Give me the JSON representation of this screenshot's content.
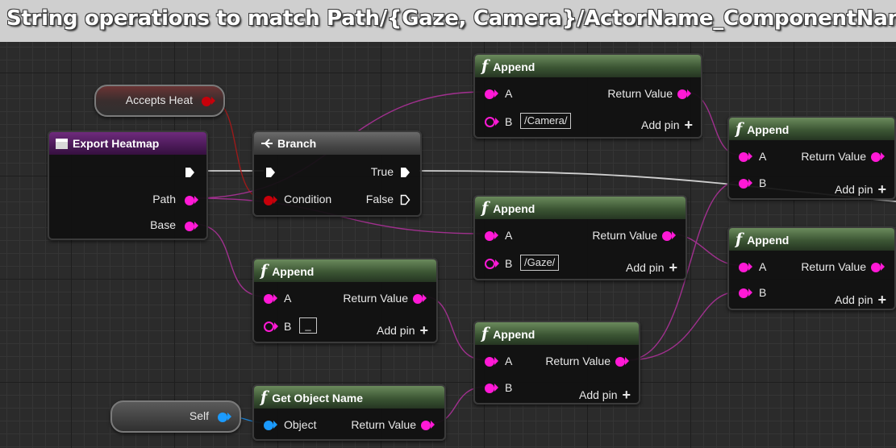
{
  "comment": {
    "title": "String operations to match Path/{Gaze, Camera}/ActorName_ComponentName"
  },
  "colors": {
    "string_pin": "#ff19d6",
    "object_pin": "#1b9bff",
    "bool_pin": "#c8000a",
    "exec_pin": "#ffffff",
    "function_header": "#3c5634",
    "event_header": "#4b1a58"
  },
  "icons": {
    "function": "f",
    "branch": "branch-icon",
    "event": "event-icon"
  },
  "nodes": {
    "accepts_heat": {
      "label": "Accepts Heat"
    },
    "export_heatmap": {
      "title": "Export Heatmap",
      "path": "Path",
      "base": "Base"
    },
    "branch": {
      "title": "Branch",
      "condition": "Condition",
      "true": "True",
      "false": "False"
    },
    "append_camera": {
      "title": "Append",
      "a": "A",
      "b": "B",
      "b_value": "/Camera/",
      "return": "Return Value",
      "add_pin": "Add pin"
    },
    "append_gaze": {
      "title": "Append",
      "a": "A",
      "b": "B",
      "b_value": "/Gaze/",
      "return": "Return Value",
      "add_pin": "Add pin"
    },
    "append_underscore": {
      "title": "Append",
      "a": "A",
      "b": "B",
      "b_value": "_",
      "return": "Return Value",
      "add_pin": "Add pin"
    },
    "append_final": {
      "title": "Append",
      "a": "A",
      "b": "B",
      "return": "Return Value",
      "add_pin": "Add pin"
    },
    "append_right_top": {
      "title": "Append",
      "a": "A",
      "b": "B",
      "return": "Return Value",
      "add_pin": "Add pin"
    },
    "append_right_mid": {
      "title": "Append",
      "a": "A",
      "b": "B",
      "return": "Return Value",
      "add_pin": "Add pin"
    },
    "get_object_name": {
      "title": "Get Object Name",
      "object": "Object",
      "return": "Return Value"
    },
    "self": {
      "label": "Self"
    }
  }
}
